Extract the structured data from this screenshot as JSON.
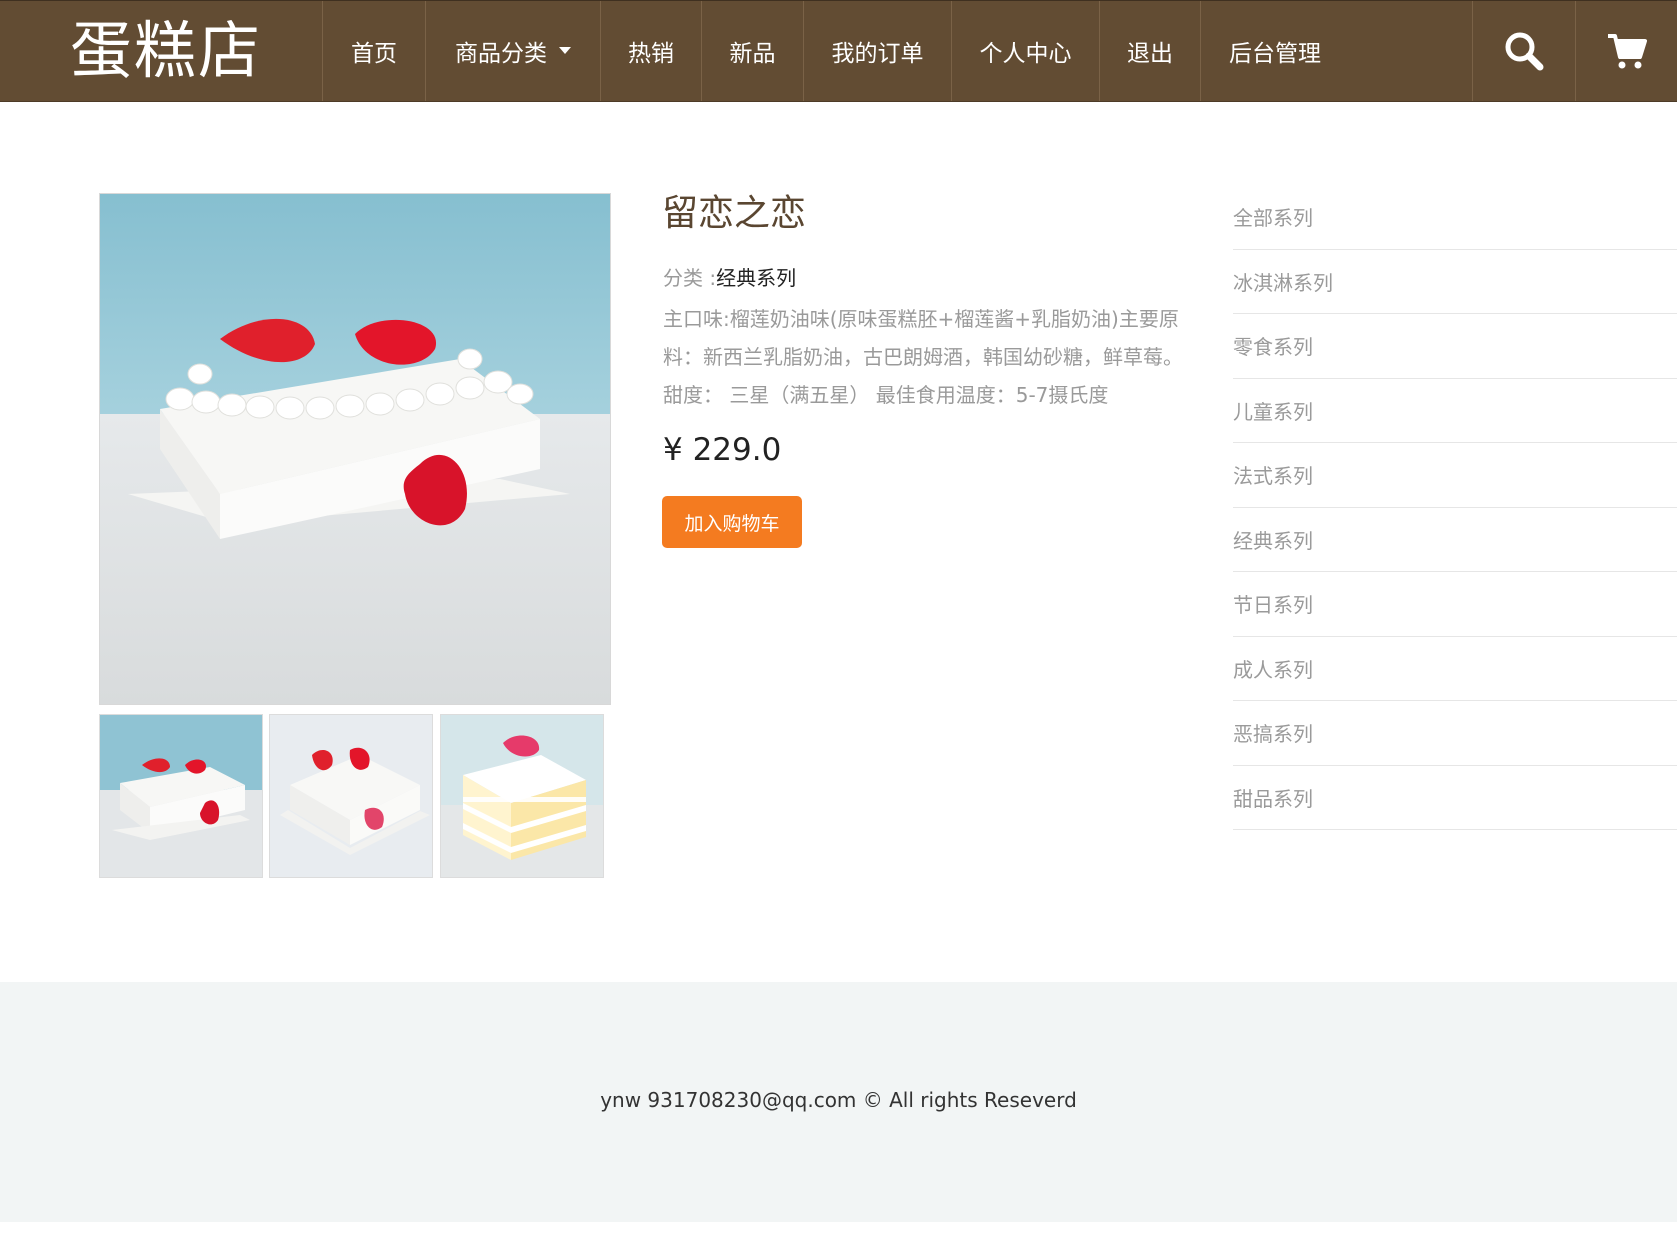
{
  "brand": {
    "name": "蛋糕店"
  },
  "nav": {
    "items": [
      {
        "label": "首页"
      },
      {
        "label": "商品分类",
        "has_dropdown": true
      },
      {
        "label": "热销"
      },
      {
        "label": "新品"
      },
      {
        "label": "我的订单"
      },
      {
        "label": "个人中心"
      },
      {
        "label": "退出"
      },
      {
        "label": "后台管理"
      }
    ],
    "icons": [
      "search-icon",
      "cart-icon"
    ]
  },
  "product": {
    "title": "留恋之恋",
    "category_label": "分类 :",
    "category_value": "经典系列",
    "description": "主口味:榴莲奶油味(原味蛋糕胚+榴莲酱+乳脂奶油)主要原料：新西兰乳脂奶油，古巴朗姆酒，韩国幼砂糖，鲜草莓。 甜度： 三星（满五星） 最佳食用温度：5-7摄氏度",
    "price": "¥ 229.0",
    "add_to_cart": "加入购物车"
  },
  "sidebar": {
    "items": [
      "全部系列",
      "冰淇淋系列",
      "零食系列",
      "儿童系列",
      "法式系列",
      "经典系列",
      "节日系列",
      "成人系列",
      "恶搞系列",
      "甜品系列"
    ]
  },
  "footer": {
    "text": "ynw 931708230@qq.com © All rights Reseverd"
  },
  "colors": {
    "navbar": "#624c33",
    "accent_button": "#f47b20",
    "title": "#5a4631",
    "footer_bg": "#f2f5f5"
  }
}
